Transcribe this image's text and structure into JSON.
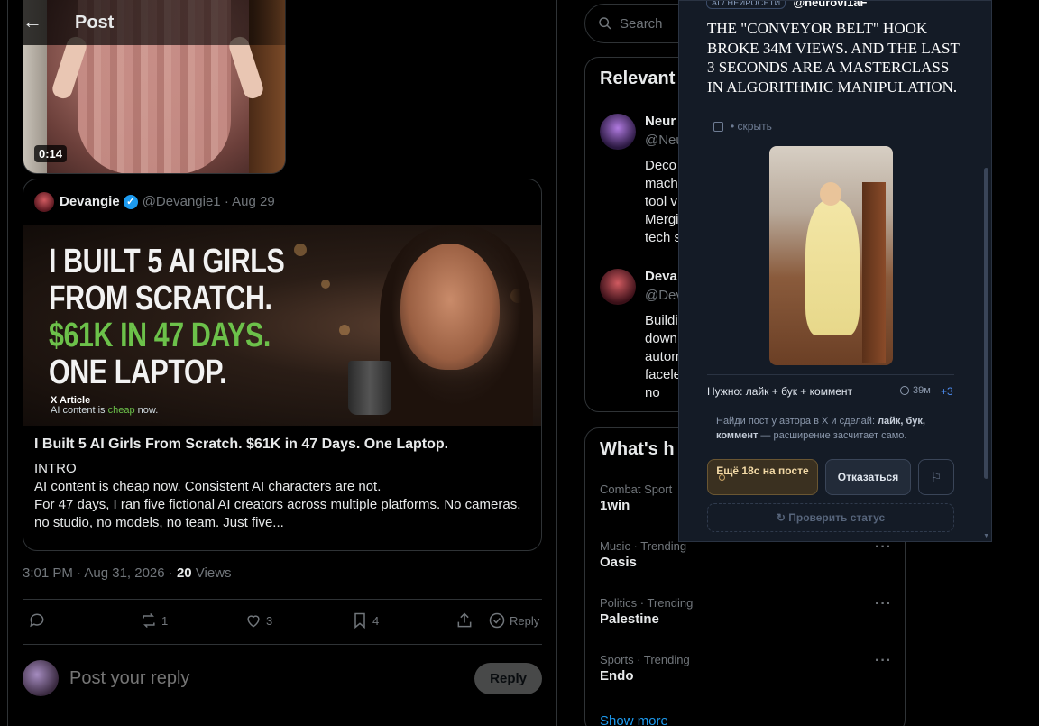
{
  "header": {
    "title": "Post",
    "back_label": "←"
  },
  "video": {
    "duration": "0:14"
  },
  "quote": {
    "name": "Devangie",
    "handle": "@Devangie1 · Aug 29",
    "image_lines": [
      "I BUILT 5 AI GIRLS",
      "FROM SCRATCH.",
      "$61K IN 47 DAYS.",
      "ONE LAPTOP."
    ],
    "x_article": "X Article",
    "tagline_pre": "AI content is ",
    "tagline_cheap": "cheap",
    "tagline_post": " now.",
    "title": "I Built 5 AI Girls From Scratch. $61K in 47 Days. One Laptop.",
    "body": [
      "INTRO",
      "AI content is cheap now. Consistent AI characters are not.",
      "For 47 days, I ran five fictional AI creators across multiple platforms. No cameras, no studio, no models, no team. Just five..."
    ]
  },
  "meta": {
    "time": "3:01 PM · Aug 31, 2026 · ",
    "views_count": "20",
    "views_label": " Views"
  },
  "actions": {
    "retweets": "1",
    "likes": "3",
    "bookmarks": "4",
    "reply_label": "Reply"
  },
  "reply_box": {
    "placeholder": "Post your reply",
    "button": "Reply"
  },
  "search": {
    "placeholder": "Search"
  },
  "relevant": {
    "title": "Relevant",
    "users": [
      {
        "name": "Neur",
        "handle": "@Neu",
        "bio": [
          "Deco",
          "mach",
          "tool v",
          "Mergi",
          "tech s"
        ]
      },
      {
        "name": "Deva",
        "handle": "@Dev",
        "bio": [
          "Buildi",
          "down",
          "autom",
          "facele",
          "no"
        ]
      }
    ]
  },
  "trends": {
    "title": "What's h",
    "items": [
      {
        "category": "Combat Sport",
        "name": "1win"
      },
      {
        "category": "Music · Trending",
        "name": "Oasis"
      },
      {
        "category": "Politics · Trending",
        "name": "Palestine"
      },
      {
        "category": "Sports · Trending",
        "name": "Endo"
      }
    ],
    "show_more": "Show more"
  },
  "ext": {
    "tag": "AI / НЕЙРОСЕТИ",
    "handle": "@neurovi1aF",
    "title": "THE \"CONVEYOR BELT\" HOOK BROKE 34M VIEWS. AND THE LAST 3 SECONDS ARE A MASTERCLASS IN ALGORITHMIC MANIPULATION.",
    "hide_label": "• скрыть",
    "need_label": "Нужно: лайк + бук + коммент",
    "time": "39м",
    "plus": "+3",
    "hint_pre": "Найди пост у автора в X и сделай: ",
    "hint_bold": "лайк, бук, коммент",
    "hint_post": " — расширение засчитает само.",
    "wait_button": "Ещё 18с на посте",
    "refuse_button": "Отказаться",
    "flag_icon": "⚐",
    "check_button": "Проверить статус"
  },
  "colors": {
    "accent": "#1d9bf0",
    "headline_green": "#6cc14a",
    "ext_bg": "#141b26"
  }
}
